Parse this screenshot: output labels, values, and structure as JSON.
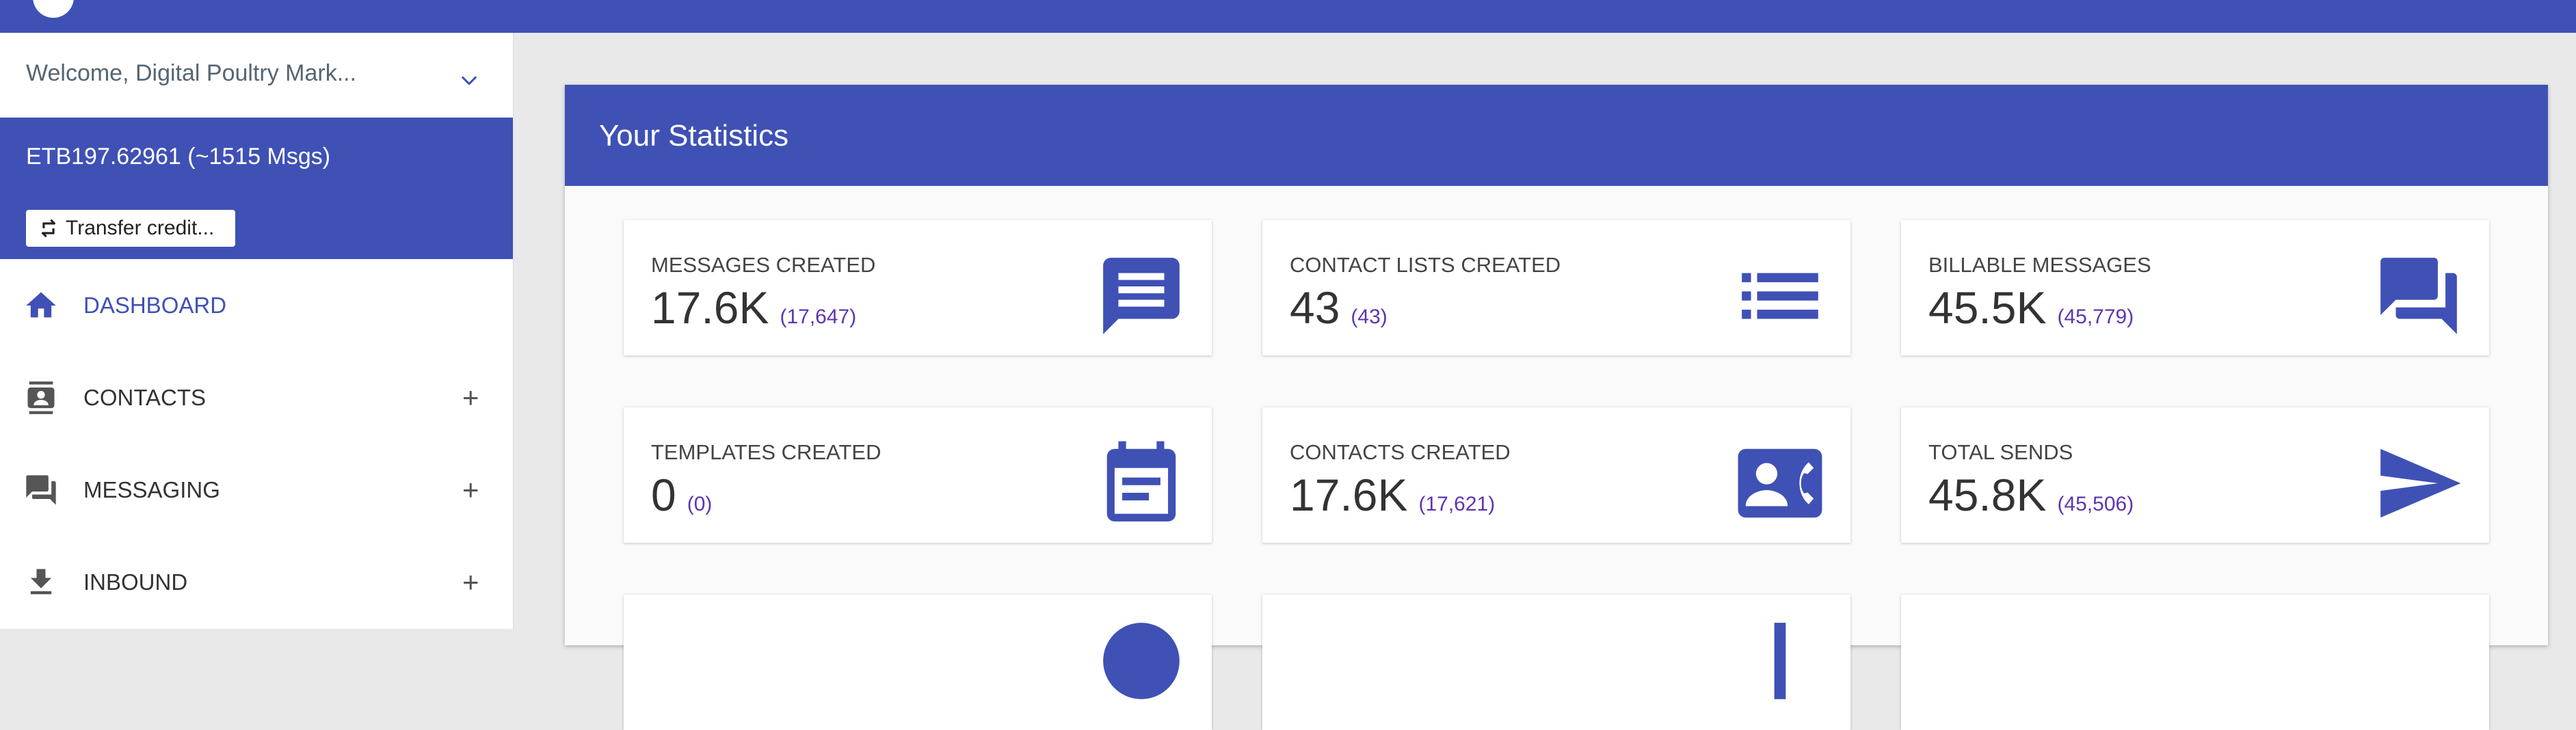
{
  "colors": {
    "primary": "#3f51b5",
    "accent_number": "#5e35b1",
    "background": "#e9e9e9"
  },
  "sidebar": {
    "welcome": "Welcome, Digital Poultry Mark...",
    "welcome_icon": "chevron-down-icon",
    "balance": "ETB197.62961 (~1515 Msgs)",
    "transfer_label": "Transfer credit...",
    "transfer_icon": "transfer-icon",
    "nav": [
      {
        "label": "DASHBOARD",
        "icon": "home-icon",
        "active": true
      },
      {
        "label": "CONTACTS",
        "icon": "contacts-icon",
        "expand": "+"
      },
      {
        "label": "MESSAGING",
        "icon": "messaging-icon",
        "expand": "+"
      },
      {
        "label": "INBOUND",
        "icon": "download-icon",
        "expand": "+"
      }
    ]
  },
  "stats": {
    "title": "Your Statistics",
    "tiles": [
      {
        "label": "MESSAGES CREATED",
        "value": "17.6K",
        "exact": "(17,647)",
        "icon": "message-icon"
      },
      {
        "label": "CONTACT LISTS CREATED",
        "value": "43",
        "exact": "(43)",
        "icon": "list-icon"
      },
      {
        "label": "BILLABLE MESSAGES",
        "value": "45.5K",
        "exact": "(45,779)",
        "icon": "forum-icon"
      },
      {
        "label": "TEMPLATES CREATED",
        "value": "0",
        "exact": "(0)",
        "icon": "calendar-icon"
      },
      {
        "label": "CONTACTS CREATED",
        "value": "17.6K",
        "exact": "(17,621)",
        "icon": "contact-phone-icon"
      },
      {
        "label": "TOTAL SENDS",
        "value": "45.8K",
        "exact": "(45,506)",
        "icon": "send-icon"
      }
    ]
  }
}
